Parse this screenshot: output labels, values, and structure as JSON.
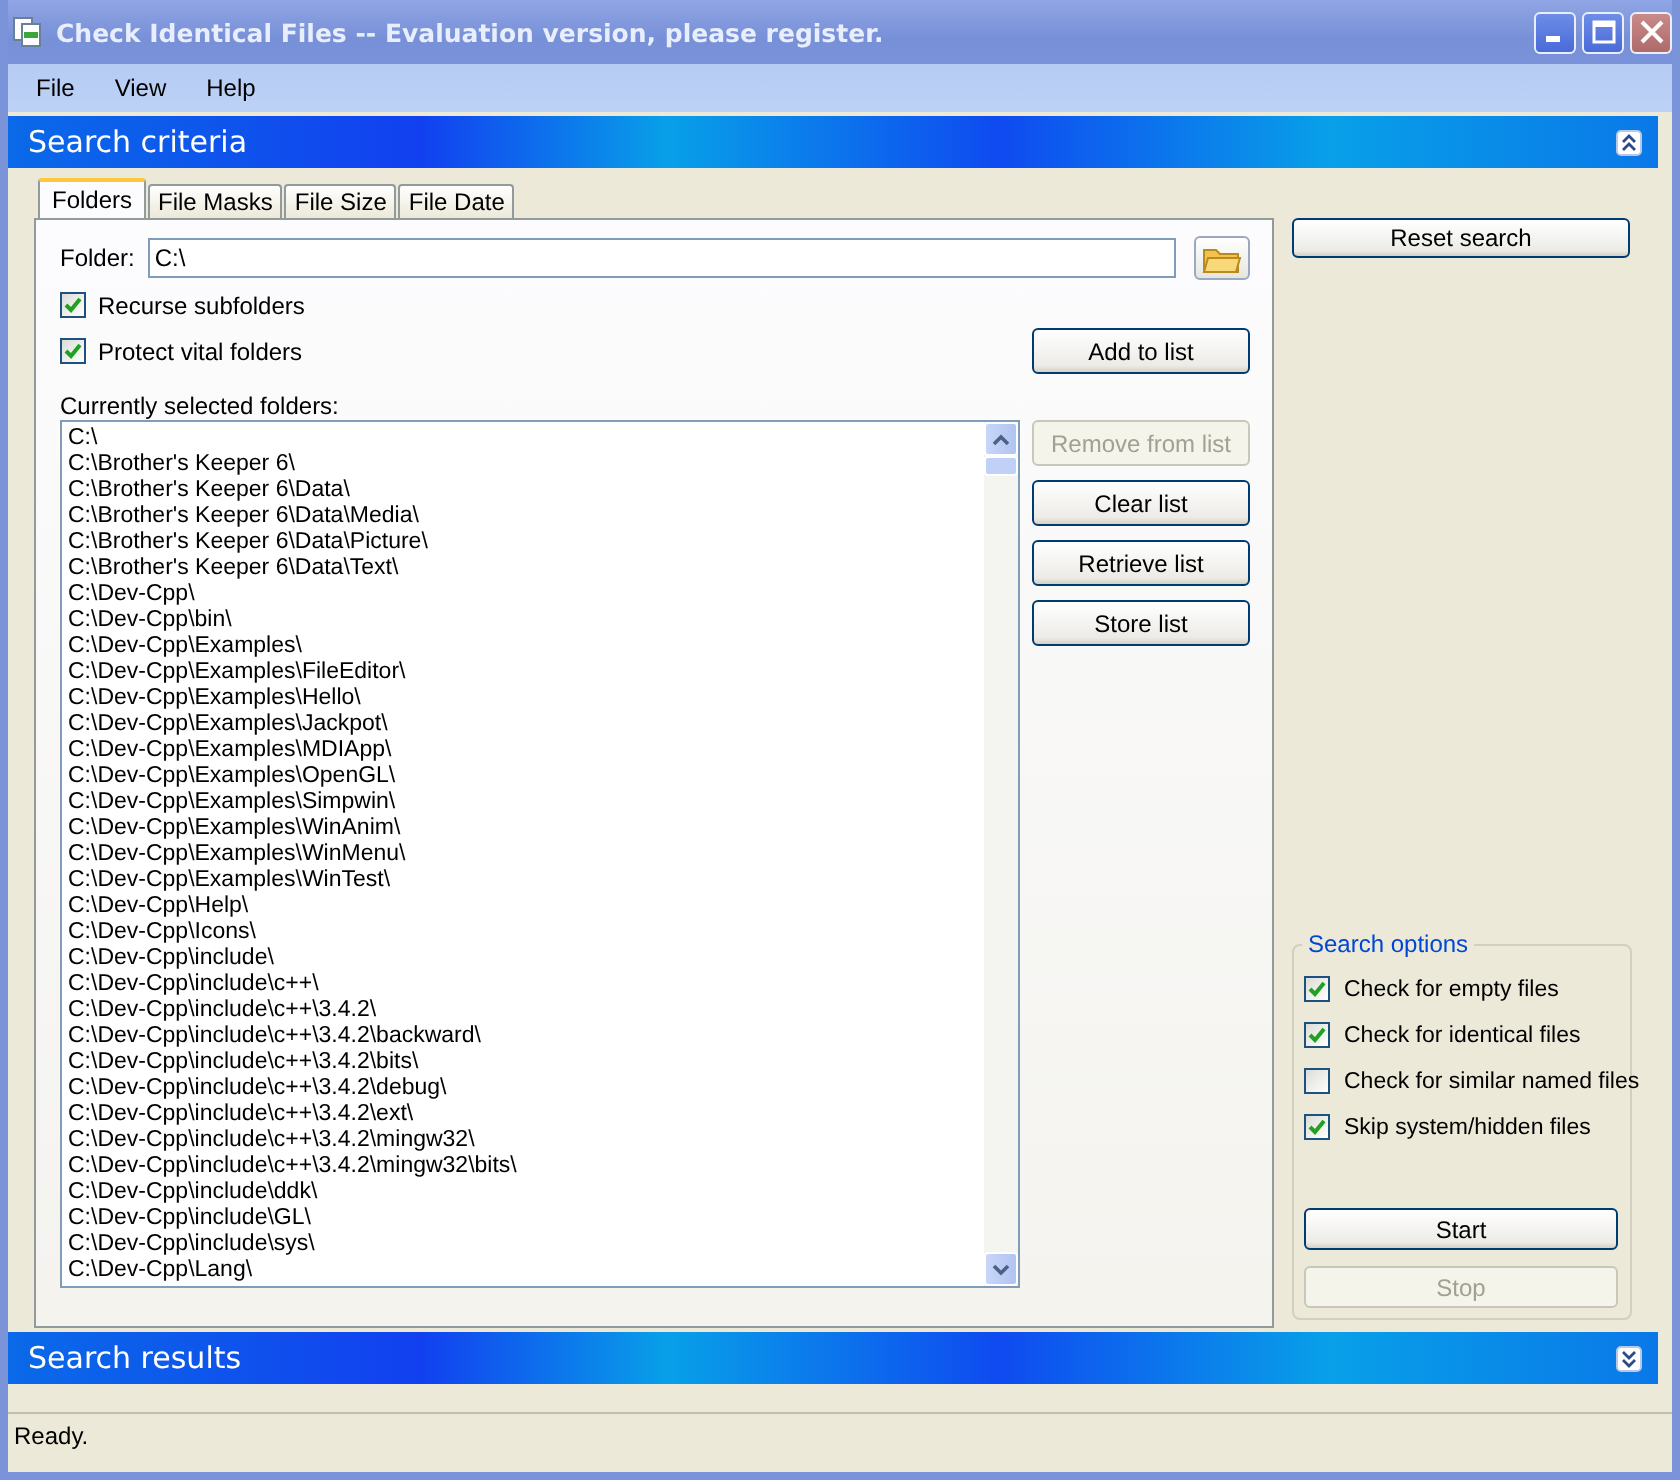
{
  "window": {
    "title": "Check Identical Files -- Evaluation version, please register."
  },
  "menu": [
    "File",
    "View",
    "Help"
  ],
  "criteria_section": {
    "title": "Search criteria",
    "expanded": true
  },
  "tabs": [
    {
      "label": "Folders",
      "selected": true
    },
    {
      "label": "File Masks",
      "selected": false
    },
    {
      "label": "File Size",
      "selected": false
    },
    {
      "label": "File Date",
      "selected": false
    }
  ],
  "folder": {
    "label": "Folder:",
    "value": "C:\\"
  },
  "folder_options": [
    {
      "label": "Recurse subfolders",
      "checked": true
    },
    {
      "label": "Protect vital folders",
      "checked": true
    }
  ],
  "add_button": {
    "label": "Add to list",
    "disabled": false
  },
  "list_label": "Currently selected folders:",
  "folders": [
    "C:\\",
    "C:\\Brother's Keeper 6\\",
    "C:\\Brother's Keeper 6\\Data\\",
    "C:\\Brother's Keeper 6\\Data\\Media\\",
    "C:\\Brother's Keeper 6\\Data\\Picture\\",
    "C:\\Brother's Keeper 6\\Data\\Text\\",
    "C:\\Dev-Cpp\\",
    "C:\\Dev-Cpp\\bin\\",
    "C:\\Dev-Cpp\\Examples\\",
    "C:\\Dev-Cpp\\Examples\\FileEditor\\",
    "C:\\Dev-Cpp\\Examples\\Hello\\",
    "C:\\Dev-Cpp\\Examples\\Jackpot\\",
    "C:\\Dev-Cpp\\Examples\\MDIApp\\",
    "C:\\Dev-Cpp\\Examples\\OpenGL\\",
    "C:\\Dev-Cpp\\Examples\\Simpwin\\",
    "C:\\Dev-Cpp\\Examples\\WinAnim\\",
    "C:\\Dev-Cpp\\Examples\\WinMenu\\",
    "C:\\Dev-Cpp\\Examples\\WinTest\\",
    "C:\\Dev-Cpp\\Help\\",
    "C:\\Dev-Cpp\\Icons\\",
    "C:\\Dev-Cpp\\include\\",
    "C:\\Dev-Cpp\\include\\c++\\",
    "C:\\Dev-Cpp\\include\\c++\\3.4.2\\",
    "C:\\Dev-Cpp\\include\\c++\\3.4.2\\backward\\",
    "C:\\Dev-Cpp\\include\\c++\\3.4.2\\bits\\",
    "C:\\Dev-Cpp\\include\\c++\\3.4.2\\debug\\",
    "C:\\Dev-Cpp\\include\\c++\\3.4.2\\ext\\",
    "C:\\Dev-Cpp\\include\\c++\\3.4.2\\mingw32\\",
    "C:\\Dev-Cpp\\include\\c++\\3.4.2\\mingw32\\bits\\",
    "C:\\Dev-Cpp\\include\\ddk\\",
    "C:\\Dev-Cpp\\include\\GL\\",
    "C:\\Dev-Cpp\\include\\sys\\",
    "C:\\Dev-Cpp\\Lang\\"
  ],
  "list_buttons": [
    {
      "label": "Remove from list",
      "disabled": true
    },
    {
      "label": "Clear list",
      "disabled": false
    },
    {
      "label": "Retrieve list",
      "disabled": false
    },
    {
      "label": "Store list",
      "disabled": false
    }
  ],
  "reset_button": {
    "label": "Reset search",
    "disabled": false
  },
  "search_options": {
    "title": "Search options",
    "options": [
      {
        "label": "Check for empty files",
        "checked": true
      },
      {
        "label": "Check for identical files",
        "checked": true
      },
      {
        "label": "Check for similar named files",
        "checked": false
      },
      {
        "label": "Skip system/hidden files",
        "checked": true
      }
    ]
  },
  "run_buttons": [
    {
      "label": "Start",
      "disabled": false
    },
    {
      "label": "Stop",
      "disabled": true
    }
  ],
  "results_section": {
    "title": "Search results",
    "expanded": false
  },
  "status_bar": "Ready."
}
